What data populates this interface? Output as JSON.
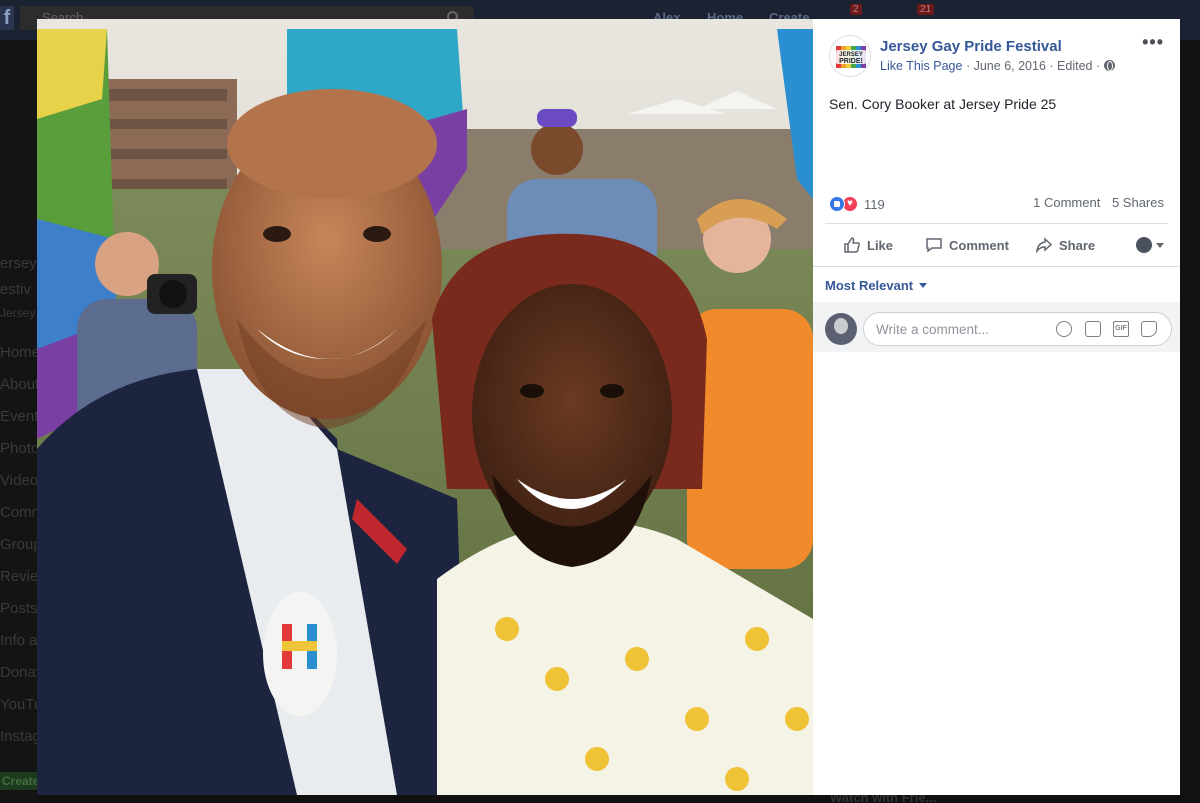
{
  "background": {
    "search_placeholder": "Search",
    "nav": [
      "Alex",
      "Home",
      "Create"
    ],
    "badges": [
      "2",
      "21"
    ],
    "side_fragments": [
      "ersey",
      "estiv",
      "Jersey",
      "Home",
      "About",
      "Events",
      "Photos",
      "Videos",
      "Commu",
      "Groups",
      "Reviews",
      "Posts",
      "Info an",
      "Donate",
      "YouTub",
      "Instag"
    ],
    "create_button": "Create",
    "bottom_text": "Watch with Frie..."
  },
  "post": {
    "page_name": "Jersey Gay Pride Festival",
    "like_page": "Like This Page",
    "date": "June 6, 2016",
    "edited": "Edited",
    "separator": "·",
    "more": "•••",
    "text": "Sen. Cory Booker at Jersey Pride 25",
    "reaction_count": "119",
    "comments_count": "1 Comment",
    "shares_count": "5 Shares",
    "actions": {
      "like": "Like",
      "comment": "Comment",
      "share": "Share"
    },
    "filter": "Most Relevant",
    "comment_placeholder": "Write a comment...",
    "gif_label": "GIF",
    "logo_text": "JERSEY PRIDE!"
  },
  "colors": {
    "link": "#365899",
    "like_blue": "#3578e5",
    "love_red": "#f33e58"
  }
}
